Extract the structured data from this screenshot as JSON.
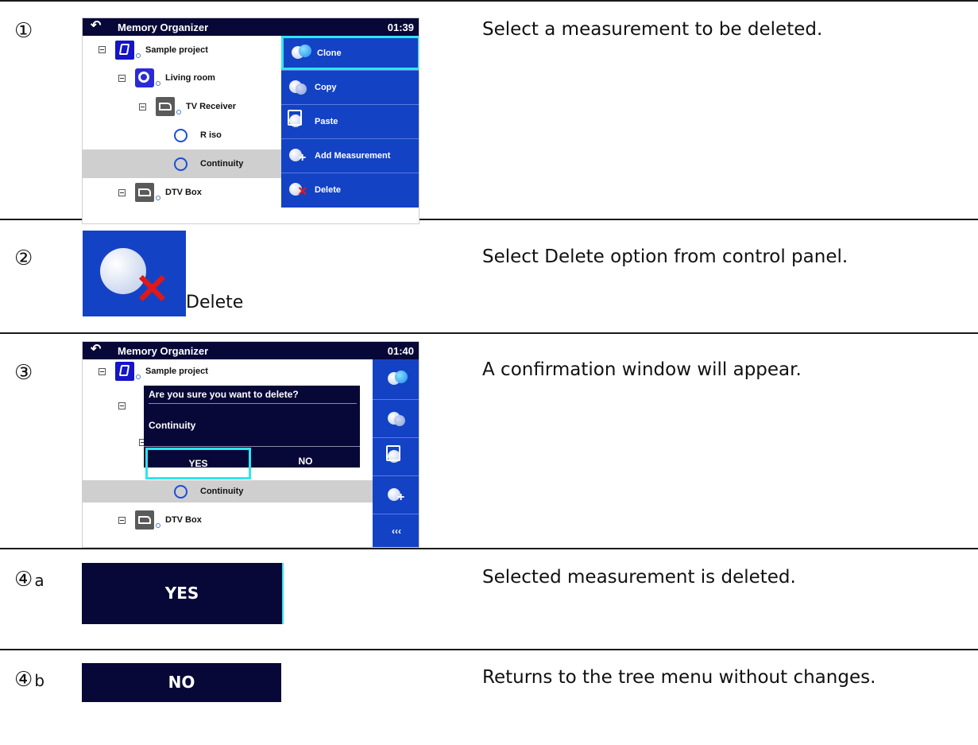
{
  "steps": [
    {
      "marker": "①",
      "text": "Select a measurement to be deleted."
    },
    {
      "marker": "②",
      "text": "Select Delete option from control panel."
    },
    {
      "marker": "③",
      "text": "A confirmation window will appear."
    },
    {
      "marker": "④",
      "sub": "a",
      "text": "Selected measurement is deleted."
    },
    {
      "marker": "④",
      "sub": "b",
      "text": "Returns to the tree menu without changes."
    }
  ],
  "screen1": {
    "back_icon": "↶",
    "title": "Memory Organizer",
    "time": "01:39",
    "tree": [
      "Sample project",
      "Living room",
      "TV Receiver",
      "R iso",
      "Continuity",
      "DTV Box"
    ],
    "panel": [
      "Clone",
      "Copy",
      "Paste",
      "Add Measurement",
      "Delete"
    ]
  },
  "step2": {
    "label": "Delete"
  },
  "screen3": {
    "back_icon": "↶",
    "title": "Memory Organizer",
    "time": "01:40",
    "tree": [
      "Sample project",
      "Continuity",
      "DTV Box"
    ],
    "dialog_question": "Are you sure you want to delete?",
    "dialog_item": "Continuity",
    "yes": "YES",
    "no": "NO",
    "more": "‹‹‹"
  },
  "step4a": {
    "label": "YES"
  },
  "step4b": {
    "label": "NO"
  },
  "colors": {
    "header": "#080838",
    "panel": "#1442c4",
    "highlight": "#2ee6ee",
    "selected_row": "#cfcfcf"
  }
}
